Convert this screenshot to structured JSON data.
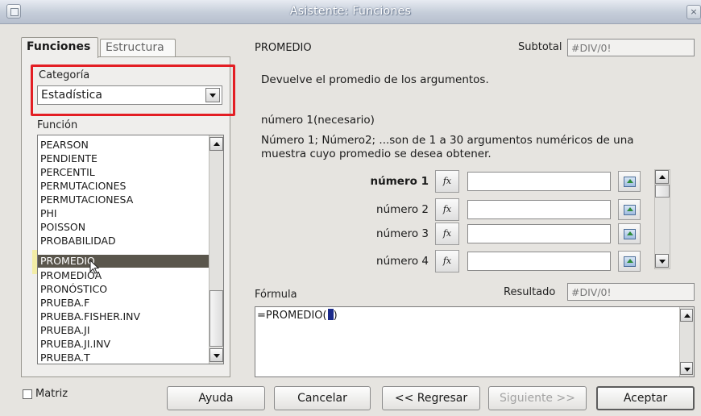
{
  "window": {
    "title": "Asistente: Funciones",
    "close_glyph": "×"
  },
  "tabs": [
    {
      "label": "Funciones",
      "active": true
    },
    {
      "label": "Estructura",
      "active": false
    }
  ],
  "category": {
    "label": "Categoría",
    "value": "Estadística"
  },
  "function_list": {
    "label": "Función",
    "items": [
      "PEARSON",
      "PENDIENTE",
      "PERCENTIL",
      "PERMUTACIONES",
      "PERMUTACIONESA",
      "PHI",
      "POISSON",
      "PROBABILIDAD",
      "PROMEDIO",
      "PROMEDIOA",
      "PRONÓSTICO",
      "PRUEBA.F",
      "PRUEBA.FISHER.INV",
      "PRUEBA.JI",
      "PRUEBA.JI.INV",
      "PRUEBA.T"
    ],
    "selected": "PROMEDIO"
  },
  "details": {
    "function_name": "PROMEDIO",
    "subtotal_label": "Subtotal",
    "subtotal_value": "#DIV/0!",
    "description": "Devuelve el promedio de los argumentos.",
    "arg_title": "número 1(necesario)",
    "arg_description_line1": "Número 1; Número2; ...son de 1 a 30 argumentos numéricos de una",
    "arg_description_line2": "muestra cuyo promedio se desea obtener."
  },
  "arguments": [
    {
      "label": "número 1",
      "value": "",
      "bold": true
    },
    {
      "label": "número 2",
      "value": "",
      "bold": false
    },
    {
      "label": "número 3",
      "value": "",
      "bold": false
    },
    {
      "label": "número 4",
      "value": "",
      "bold": false
    }
  ],
  "fx_label": "fx",
  "formula": {
    "label": "Fórmula",
    "result_label": "Resultado",
    "result_value": "#DIV/0!",
    "text_before": "=PROMEDIO(",
    "text_after": ")"
  },
  "footer": {
    "matrix_label": "Matriz",
    "matrix_checked": false,
    "help": "Ayuda",
    "cancel": "Cancelar",
    "back": "<< Regresar",
    "next": "Siguiente >>",
    "accept": "Aceptar"
  },
  "colors": {
    "highlight_red": "#e31e24",
    "highlight_yellow": "#f5ec6e",
    "selected_row": "#5a564c"
  },
  "icons": [
    "app-icon",
    "close-icon",
    "chevron-down-icon",
    "fx-icon",
    "shrink-icon",
    "mouse-cursor-icon"
  ]
}
